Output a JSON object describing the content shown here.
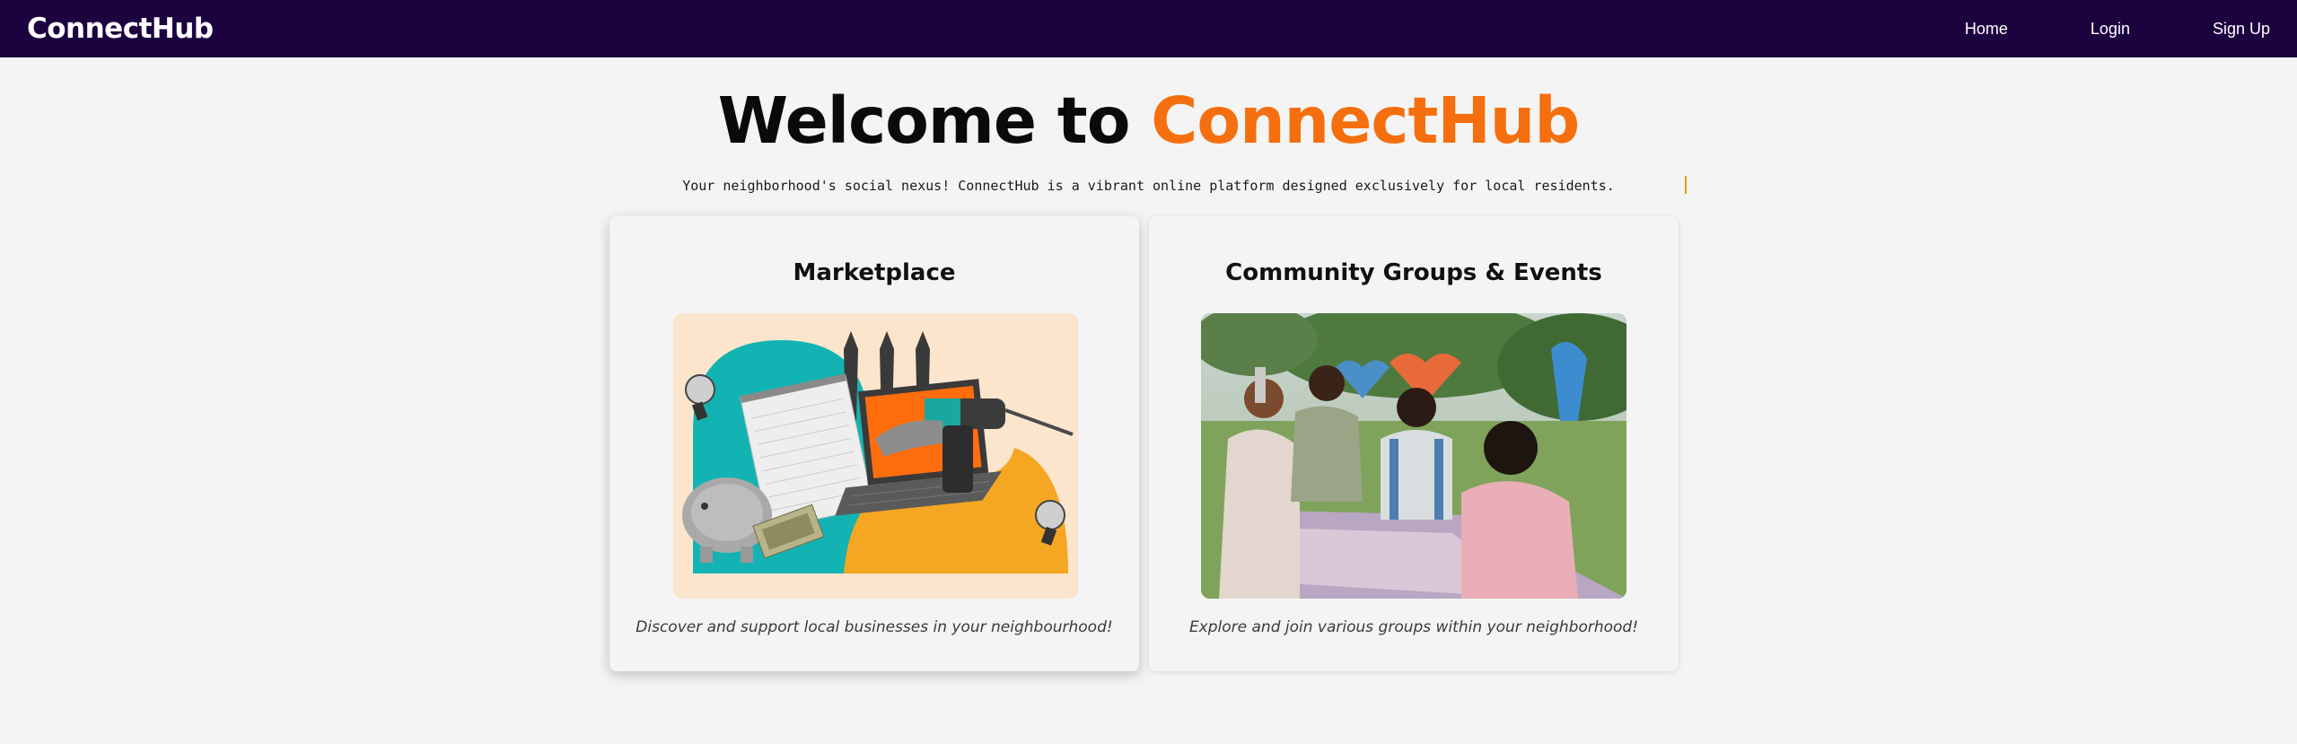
{
  "navbar": {
    "brand": "ConnectHub",
    "links": [
      {
        "label": "Home"
      },
      {
        "label": "Login"
      },
      {
        "label": "Sign Up"
      }
    ]
  },
  "hero": {
    "title_prefix": "Welcome to ",
    "title_accent": "ConnectHub",
    "tagline": "Your neighborhood's social nexus! ConnectHub is a vibrant online platform designed exclusively for local residents."
  },
  "cards": [
    {
      "title": "Marketplace",
      "caption": "Discover and support local businesses in your neighbourhood!"
    },
    {
      "title": "Community Groups & Events",
      "caption": "Explore and join various groups within your neighborhood!"
    }
  ],
  "colors": {
    "navbar_bg": "#1c0340",
    "accent": "#f56f0f",
    "page_bg": "#f4f4f4"
  }
}
